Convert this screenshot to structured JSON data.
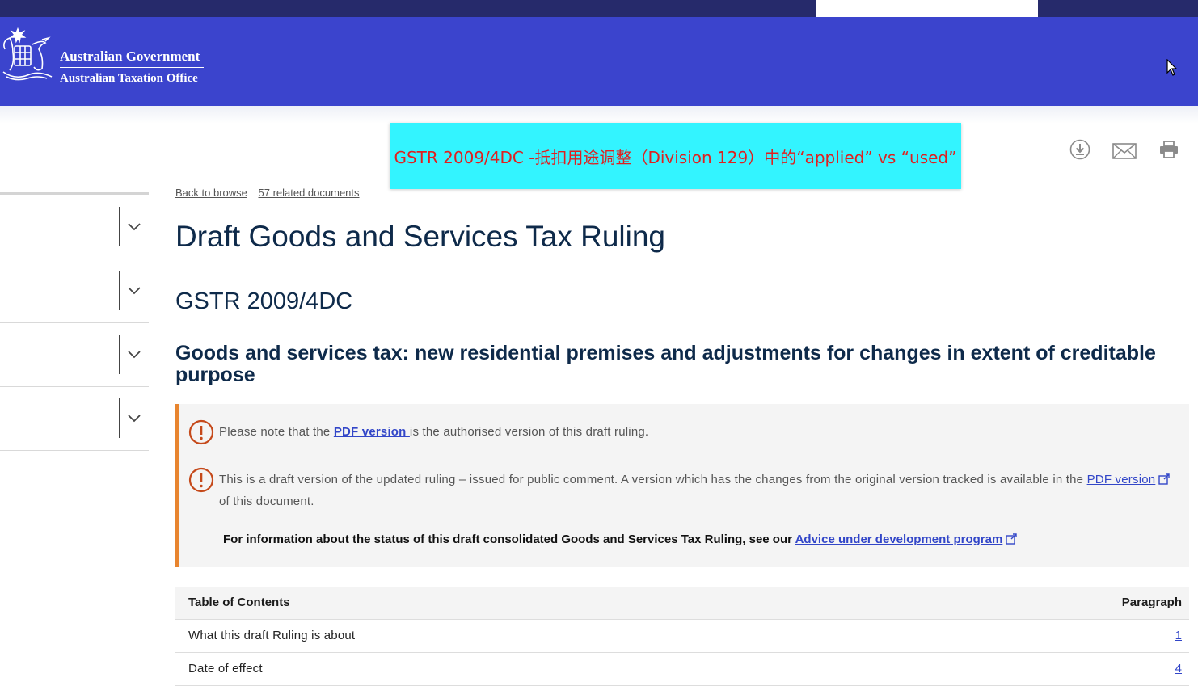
{
  "header": {
    "gov_name": "Australian Government",
    "agency_name": "Australian Taxation Office"
  },
  "banner": {
    "text": "GSTR 2009/4DC -抵扣用途调整（Division 129）中的“applied” vs “used”"
  },
  "actions": [
    "download-icon",
    "email-icon",
    "print-icon"
  ],
  "breadcrumbs": {
    "back": "Back to browse",
    "related": "57 related documents"
  },
  "document": {
    "title": "Draft Goods and Services Tax Ruling",
    "ruling_id": "GSTR 2009/4DC",
    "subject": "Goods and services tax: new residential premises and adjustments for changes in extent of creditable purpose"
  },
  "notice": {
    "n1_before": "Please note that the ",
    "n1_link": "PDF version ",
    "n1_after": "is the authorised version of this draft ruling.",
    "n2_before": "This is a draft version of the updated ruling – issued for public comment. A version which has the changes from the original version tracked is available in the ",
    "n2_link": "PDF version",
    "n2_after": " of this document.",
    "n3_before": "For information about the status of this draft consolidated Goods and Services Tax Ruling, see our ",
    "n3_link": "Advice under development program"
  },
  "toc": {
    "header_left": "Table of Contents",
    "header_right": "Paragraph",
    "rows": [
      {
        "label": "What this draft Ruling is about",
        "para": "1"
      },
      {
        "label": "Date of effect",
        "para": "4"
      }
    ]
  },
  "colors": {
    "header_bg": "#3b44cd",
    "top_strip": "#262a6b",
    "banner_bg": "#33f4ff",
    "banner_text": "#e01f1f",
    "notice_accent": "#e8852f",
    "link": "#3246c8"
  }
}
